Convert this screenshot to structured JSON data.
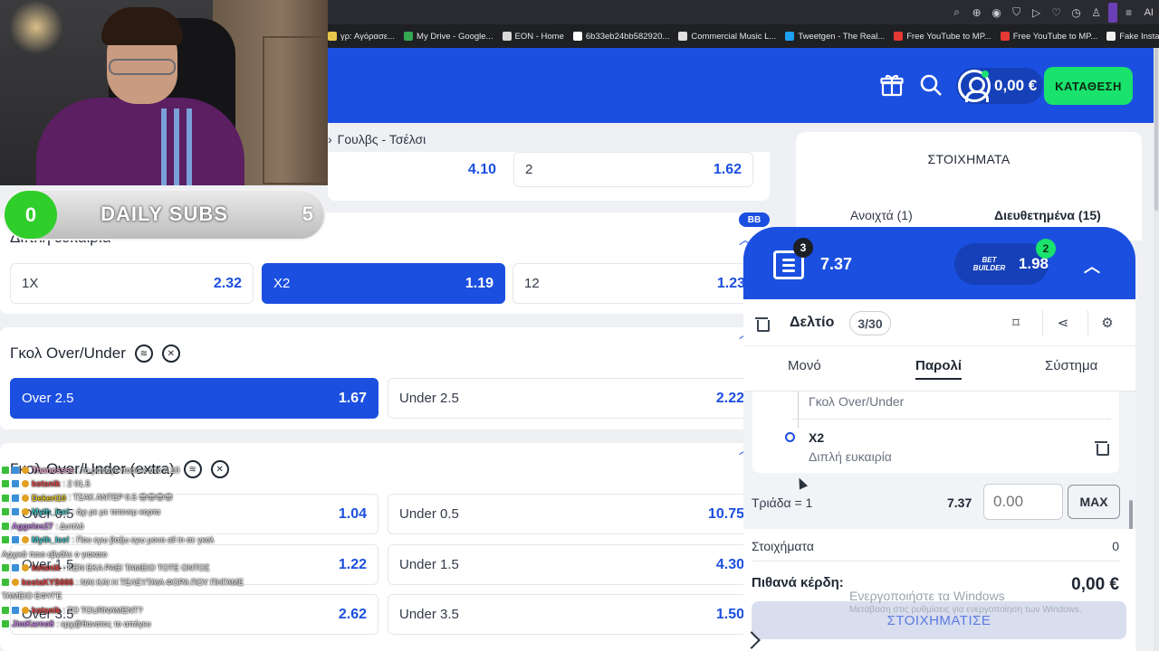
{
  "bookmarks": [
    {
      "label": "γρ: Αγόρασε...",
      "color": "#e8c84a"
    },
    {
      "label": "My Drive - Google...",
      "color": "#34a853"
    },
    {
      "label": "EON - Home",
      "color": "#d9d9d9"
    },
    {
      "label": "6b33eb24bb582920...",
      "color": "#ffffff"
    },
    {
      "label": "Commercial Music L...",
      "color": "#e0e0e0"
    },
    {
      "label": "Tweetgen - The Real...",
      "color": "#1da1f2"
    },
    {
      "label": "Free YouTube to MP...",
      "color": "#e53935"
    },
    {
      "label": "Free YouTube to MP...",
      "color": "#e53935"
    },
    {
      "label": "Fake Instagram Post...",
      "color": "#f0f0f0"
    }
  ],
  "toolbar": {
    "ai_label": "AI"
  },
  "header": {
    "balance": "0,00 €",
    "deposit_label": "ΚΑΤΑΘΕΣΗ",
    "brand_color": "#1b4fe0",
    "cta_color": "#19e36c"
  },
  "breadcrumb": {
    "match": "Γουλβς - Τσέλσι"
  },
  "match_result_row": [
    {
      "label": "",
      "value": "4.10"
    },
    {
      "label": "2",
      "value": "1.62"
    }
  ],
  "double_chance": {
    "title": "Διπλή ευκαιρία",
    "badge": "BB",
    "odds": [
      {
        "label": "1X",
        "value": "2.32",
        "selected": false
      },
      {
        "label": "X2",
        "value": "1.19",
        "selected": true
      },
      {
        "label": "12",
        "value": "1.23",
        "selected": false
      }
    ]
  },
  "goals_ou": {
    "title": "Γκολ Over/Under",
    "odds": [
      {
        "label": "Over 2.5",
        "value": "1.67",
        "selected": true
      },
      {
        "label": "Under 2.5",
        "value": "2.22",
        "selected": false
      }
    ]
  },
  "goals_ou_extra": {
    "title": "Γκολ Over/Under (extra)",
    "rows": [
      {
        "over": "Over 0.5",
        "over_val": "1.04",
        "under": "Under 0.5",
        "under_val": "10.75"
      },
      {
        "over": "Over 1.5",
        "over_val": "1.22",
        "under": "Under 1.5",
        "under_val": "4.30"
      },
      {
        "over": "Over 3.5",
        "over_val": "2.62",
        "under": "Under 3.5",
        "under_val": "1.50"
      }
    ]
  },
  "bets_panel": {
    "title": "ΣΤΟΙΧΗΜΑΤΑ",
    "tab_open": "Ανοιχτά (1)",
    "tab_settled": "Διευθετημένα (15)"
  },
  "betslip": {
    "selections_count": "3",
    "total_odds": "7.37",
    "bb_logo": "BET BUILDER",
    "bb_odds": "1.98",
    "bb_count": "2",
    "title": "Δελτίο",
    "counter": "3/30",
    "tabs": [
      "Μονό",
      "Παρολί",
      "Σύστημα"
    ],
    "prev_market": "Γκολ Over/Under",
    "selection_name": "X2",
    "selection_market": "Διπλή ευκαιρία",
    "combo_label": "Τριάδα = 1",
    "combo_odds": "7.37",
    "stake_placeholder": "0.00",
    "max_label": "MAX",
    "stakes_label": "Στοιχήματα",
    "stakes_value": "0",
    "winnings_label": "Πιθανά κέρδη:",
    "winnings_value": "0,00 €",
    "place_label": "ΣΤΟΙΧΗΜΑΤΙΣΕ"
  },
  "windows_watermark": {
    "line1": "Ενεργοποιήστε τα Windows",
    "line2": "Μετάβαση στις ρυθμίσεις για ενεργοποίηση των Windows."
  },
  "overlay": {
    "subs_current": "0",
    "subs_label": "DAILY SUBS",
    "subs_goal": "5"
  },
  "chat": [
    {
      "user": "Thanossss",
      "color": "#e8a8d0",
      "msg": ": το ρατιαγε ποσο x στο 4.10"
    },
    {
      "user": "kotsnik",
      "color": "#e04040",
      "msg": ": 2 01.5"
    },
    {
      "user": "Dekert10",
      "color": "#e0c020",
      "msg": ": ΤΣΑΚ ΑΝΤΕΡ 0.5 😎😎😎😎"
    },
    {
      "user": "Myth_Ice!",
      "color": "#40c0c0",
      "msg": ": όχι ρε με τοτενεμ κορτα"
    },
    {
      "user": "Aggelos27",
      "color": "#c080e0",
      "msg": ": Δυπλό"
    },
    {
      "user": "Myth_Ice!",
      "color": "#40c0c0",
      "msg": ": Που εγω βαζω εγω μονο all in σε γκολ"
    },
    {
      "user": "",
      "color": "#e8e8e8",
      "msg": "Αρχικά ποιο εβγάλε ο γιακαιο"
    },
    {
      "user": "kotsnik",
      "color": "#e04040",
      "msg": ": ΚΕΝ ΕΚΑ ΡΑΕΙ ΤΑΜΕΙΟ ΤΟΤΕ ΟΝΤΟΣ"
    },
    {
      "user": "kostaKYS666",
      "color": "#e04040",
      "msg": ": ΝΑΙ ΚΑΙ Η ΤΕΛΕΥΤΑΙΑ ΦΟΡΑ ΠΟΥ ΠΗΓΑΜΕ"
    },
    {
      "user": "",
      "color": "#e8e8e8",
      "msg": "ΤΑΜΕΙΟ ΕΦΥΓΕ"
    },
    {
      "user": "kotsnik",
      "color": "#e04040",
      "msg": ": ΤΟ TOURNAMENT?"
    },
    {
      "user": "JimKarno8",
      "color": "#c080e0",
      "msg": ": ερχ@θανατος το απόγευ"
    }
  ]
}
